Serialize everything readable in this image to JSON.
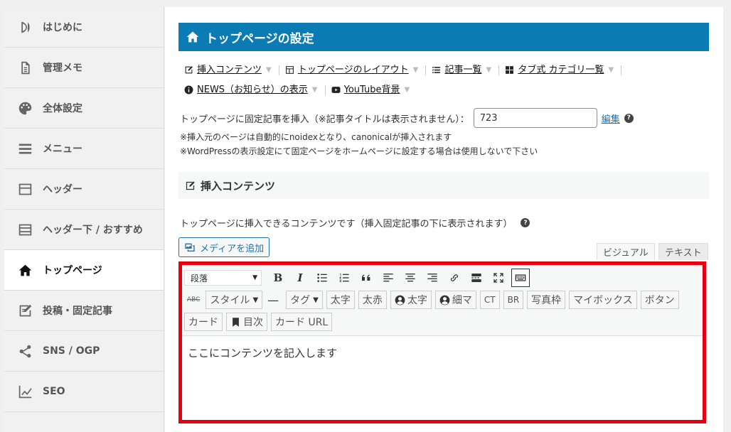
{
  "sidebar": {
    "items": [
      {
        "label": "はじめに",
        "icon": "leaf-icon",
        "active": false
      },
      {
        "label": "管理メモ",
        "icon": "document-icon",
        "active": false
      },
      {
        "label": "全体設定",
        "icon": "palette-icon",
        "active": false
      },
      {
        "label": "メニュー",
        "icon": "menu-icon",
        "active": false
      },
      {
        "label": "ヘッダー",
        "icon": "header-icon",
        "active": false
      },
      {
        "label": "ヘッダー下 / おすすめ",
        "icon": "header-below-icon",
        "active": false
      },
      {
        "label": "トップページ",
        "icon": "home-icon",
        "active": true
      },
      {
        "label": "投稿・固定記事",
        "icon": "edit-icon",
        "active": false
      },
      {
        "label": "SNS / OGP",
        "icon": "share-icon",
        "active": false
      },
      {
        "label": "SEO",
        "icon": "chart-icon",
        "active": false
      }
    ]
  },
  "page": {
    "title": "トップページの設定",
    "tabs": [
      {
        "label": "挿入コンテンツ",
        "icon": "edit-icon"
      },
      {
        "label": "トップページのレイアウト",
        "icon": "layout-icon"
      },
      {
        "label": "記事一覧",
        "icon": "list-icon"
      },
      {
        "label": "タブ式 カテゴリ一覧",
        "icon": "grid-icon"
      },
      {
        "label": "NEWS（お知らせ）の表示",
        "icon": "info-icon"
      },
      {
        "label": "YouTube背景",
        "icon": "youtube-icon"
      }
    ],
    "fixed_label": "トップページに固定記事を挿入（※記事タイトルは表示されません）：",
    "fixed_value": "723",
    "edit_link": "編集",
    "help": "?",
    "note1": "※挿入元のページは自動的にnoidexとなり、canonicalが挿入されます",
    "note2": "※WordPressの表示設定にて固定ページをホームページに設定する場合は使用しないで下さい",
    "section_title": "挿入コンテンツ",
    "description": "トップページに挿入できるコンテンツです（挿入固定記事の下に表示されます）"
  },
  "editor": {
    "media_button": "メディアを追加",
    "visual_tab": "ビジュアル",
    "text_tab": "テキスト",
    "format_select": "段落",
    "bold": "B",
    "italic": "I",
    "strike": "ABC",
    "style_btn": "スタイル",
    "hr": "—",
    "tag_btn": "タグ",
    "buttons_row2": [
      "太字",
      "太赤"
    ],
    "icon_bold": "太字",
    "icon_thin": "細マ",
    "buttons_row2b": [
      "CT",
      "BR",
      "写真枠",
      "マイボックス",
      "ボタン"
    ],
    "buttons_row3": [
      "カード"
    ],
    "toc": "目次",
    "card_url": "カード URL",
    "content": "ここにコンテンツを記入します"
  }
}
